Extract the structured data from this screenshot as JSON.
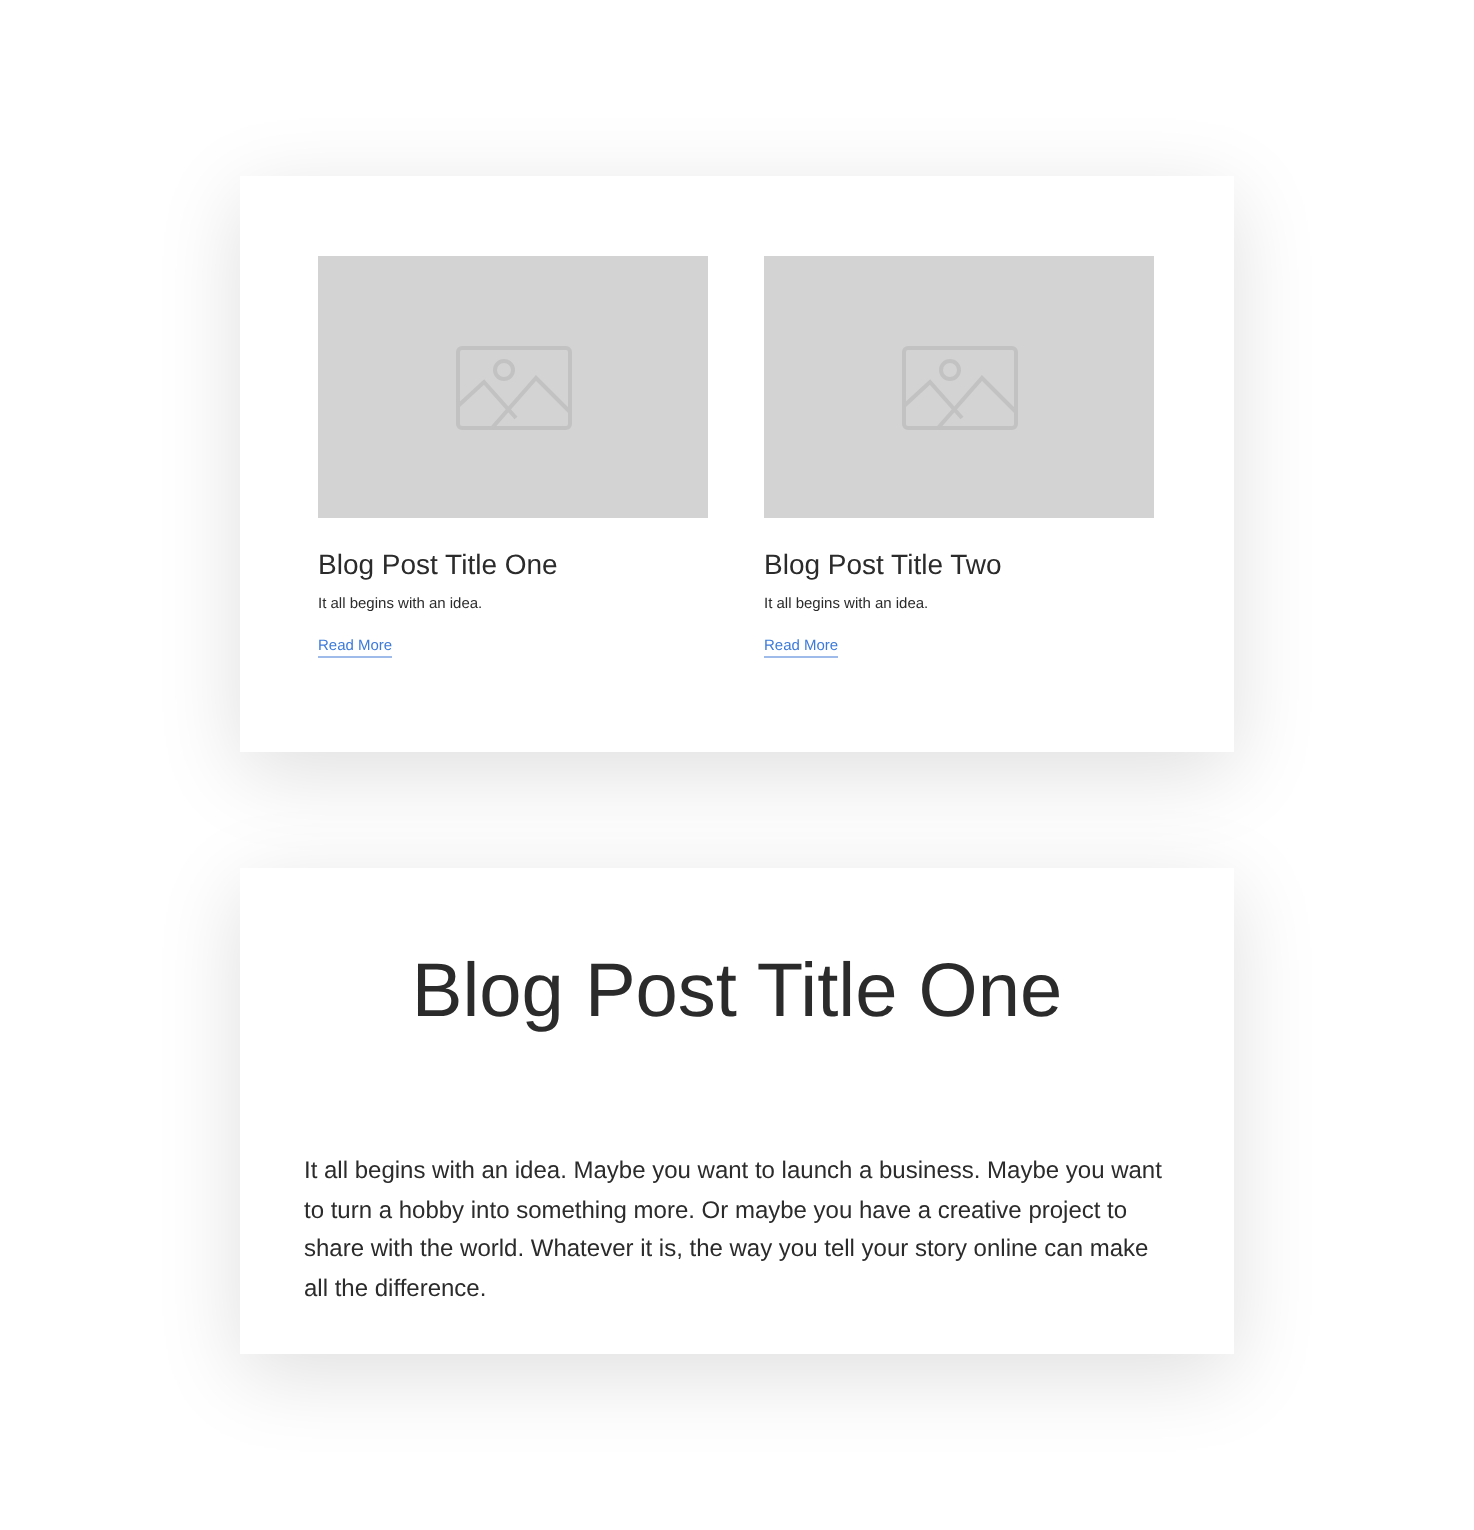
{
  "posts": [
    {
      "title": "Blog Post Title One",
      "excerpt": "It all begins with an idea.",
      "link": "Read More"
    },
    {
      "title": "Blog Post Title Two",
      "excerpt": "It all begins with an idea.",
      "link": "Read More"
    }
  ],
  "article": {
    "title": "Blog Post Title One",
    "body": "It all begins with an idea. Maybe you want to launch a business. Maybe you want to turn a hobby into something more. Or maybe you have a creative project to share with the world. Whatever it is, the way you tell your story online can make all the difference."
  }
}
